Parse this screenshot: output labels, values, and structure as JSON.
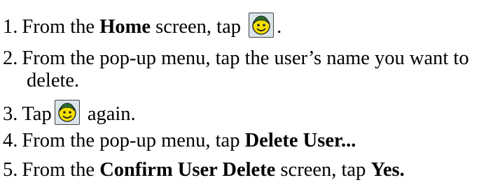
{
  "steps": [
    {
      "num": "1.",
      "pre": "From the ",
      "bold1": "Home",
      "mid": " screen, tap ",
      "post": "."
    },
    {
      "num": "2.",
      "line1": "From the pop-up menu, tap the user’s name you want to",
      "line2": "delete."
    },
    {
      "num": "3.",
      "pre": "Tap",
      "post": " again."
    },
    {
      "num": "4.",
      "pre": "From the pop-up menu, tap ",
      "bold1": "Delete User..."
    },
    {
      "num": "5.",
      "pre": "From the ",
      "bold1": "Confirm User Delete",
      "mid": " screen, tap ",
      "bold2": "Yes."
    }
  ],
  "icons": {
    "user_icon": "smiley-user-icon",
    "face_color": "#f5e000",
    "hair_color": "#2a6b2f",
    "bg_color": "#d9e3ea"
  }
}
